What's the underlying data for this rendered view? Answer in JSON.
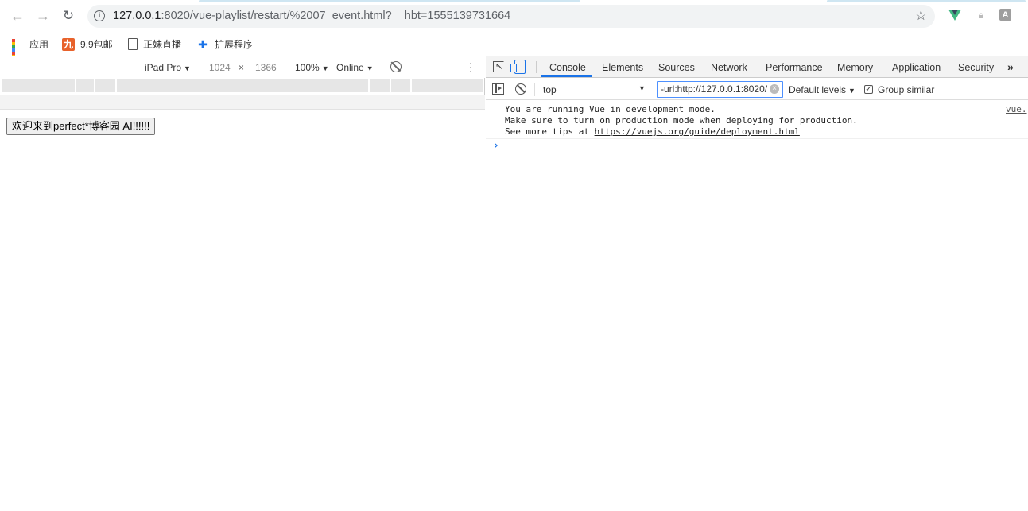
{
  "browser": {
    "url_host": "127.0.0.1",
    "url_rest": ":8020/vue-playlist/restart/%2007_event.html?__hbt=1555139731664",
    "bookmarks": [
      {
        "label": "应用",
        "icon": "apps-icon"
      },
      {
        "label": "9.9包邮",
        "icon": "nine-icon"
      },
      {
        "label": "正妹直播",
        "icon": "page-icon"
      },
      {
        "label": "扩展程序",
        "icon": "puzzle-icon"
      }
    ],
    "extension_a_label": "A"
  },
  "device_toolbar": {
    "device": "iPad Pro",
    "width": "1024",
    "times": "×",
    "height": "1366",
    "zoom": "100%",
    "network": "Online"
  },
  "page": {
    "button_label": "欢迎来到perfect*博客园 AI!!!!!!"
  },
  "devtools": {
    "tabs": [
      "Console",
      "Elements",
      "Sources",
      "Network",
      "Performance",
      "Memory",
      "Application",
      "Security"
    ],
    "active_tab": "Console",
    "more_tabs": "»",
    "console": {
      "context": "top",
      "filter_value": "-url:http://127.0.0.1:8020/",
      "levels": "Default levels",
      "group_similar_label": "Group similar",
      "group_similar_checked": true
    },
    "messages": {
      "line1": "You are running Vue in development mode.",
      "line2": "Make sure to turn on production mode when deploying for production.",
      "line3_prefix": "See more tips at ",
      "line3_link": "https://vuejs.org/guide/deployment.html",
      "source": "vue."
    },
    "prompt": "›"
  },
  "colors": {
    "accent": "#1a73e8",
    "vue_green": "#41b883",
    "vue_dark": "#35495e",
    "nine_orange": "#e8622b"
  }
}
